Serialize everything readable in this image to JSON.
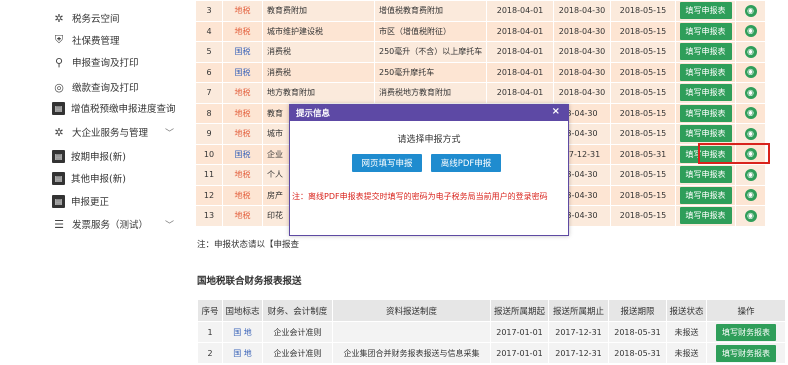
{
  "sidebar": {
    "items": [
      {
        "icon": "gear-icon",
        "glyph": "✲",
        "label": "税务云空间",
        "chev": false
      },
      {
        "icon": "shield-icon",
        "glyph": "⛨",
        "label": "社保费管理",
        "chev": false
      },
      {
        "icon": "search-icon",
        "glyph": "⚲",
        "label": "申报查询及打印",
        "chev": false
      },
      {
        "icon": "coin-icon",
        "glyph": "◎",
        "label": "缴款查询及打印",
        "chev": false
      },
      {
        "icon": "document-icon",
        "glyph": "▤",
        "label": "增值税预缴申报进度查询",
        "chev": false
      },
      {
        "icon": "gear-icon",
        "glyph": "✲",
        "label": "大企业服务与管理",
        "chev": true
      },
      {
        "icon": "document-icon",
        "glyph": "▤",
        "label": "按期申报(新)",
        "chev": false
      },
      {
        "icon": "document-icon",
        "glyph": "▤",
        "label": "其他申报(新)",
        "chev": false
      },
      {
        "icon": "document-icon",
        "glyph": "▤",
        "label": "申报更正",
        "chev": false
      },
      {
        "icon": "list-icon",
        "glyph": "☰",
        "label": "发票服务（测试）",
        "chev": true
      }
    ]
  },
  "top_table": {
    "rows": [
      {
        "no": "3",
        "tax": "地税",
        "tax_type": "dishui",
        "name": "教育费附加",
        "item": "增值税教育费附加",
        "start": "2018-04-01",
        "end": "2018-04-30",
        "deadline": "2018-05-15",
        "action": "填写申报表"
      },
      {
        "no": "4",
        "tax": "地税",
        "tax_type": "dishui",
        "name": "城市维护建设税",
        "item": "市区（增值税附征）",
        "start": "2018-04-01",
        "end": "2018-04-30",
        "deadline": "2018-05-15",
        "action": "填写申报表"
      },
      {
        "no": "5",
        "tax": "国税",
        "tax_type": "guoshui",
        "name": "消费税",
        "item": "250毫升（不含）以上摩托车",
        "start": "2018-04-01",
        "end": "2018-04-30",
        "deadline": "2018-05-15",
        "action": "填写申报表"
      },
      {
        "no": "6",
        "tax": "国税",
        "tax_type": "guoshui",
        "name": "消费税",
        "item": "250毫升摩托车",
        "start": "2018-04-01",
        "end": "2018-04-30",
        "deadline": "2018-05-15",
        "action": "填写申报表"
      },
      {
        "no": "7",
        "tax": "地税",
        "tax_type": "dishui",
        "name": "地方教育附加",
        "item": "消费税地方教育附加",
        "start": "2018-04-01",
        "end": "2018-04-30",
        "deadline": "2018-05-15",
        "action": "填写申报表"
      },
      {
        "no": "8",
        "tax": "地税",
        "tax_type": "dishui",
        "name": "教育",
        "item": "",
        "start": "",
        "end": "8-04-30",
        "deadline": "2018-05-15",
        "action": "填写申报表"
      },
      {
        "no": "9",
        "tax": "地税",
        "tax_type": "dishui",
        "name": "城市",
        "item": "",
        "start": "",
        "end": "8-04-30",
        "deadline": "2018-05-15",
        "action": "填写申报表"
      },
      {
        "no": "10",
        "tax": "国税",
        "tax_type": "guoshui",
        "name": "企业",
        "item": "",
        "start": "",
        "end": "17-12-31",
        "deadline": "2018-05-31",
        "action": "填写申报表"
      },
      {
        "no": "11",
        "tax": "地税",
        "tax_type": "dishui",
        "name": "个人",
        "item": "",
        "start": "",
        "end": "8-04-30",
        "deadline": "2018-05-15",
        "action": "填写申报表"
      },
      {
        "no": "12",
        "tax": "地税",
        "tax_type": "dishui",
        "name": "房产",
        "item": "",
        "start": "",
        "end": "8-04-30",
        "deadline": "2018-05-15",
        "action": "填写申报表"
      },
      {
        "no": "13",
        "tax": "地税",
        "tax_type": "dishui",
        "name": "印花",
        "item": "",
        "start": "",
        "end": "8-04-30",
        "deadline": "2018-05-15",
        "action": "填写申报表"
      }
    ]
  },
  "note": "注：申报状态请以【申报查",
  "section_title": "国地税联合财务报表报送",
  "bottom_table": {
    "headers": [
      "序号",
      "国地标志",
      "财务、会计制度",
      "资料报送制度",
      "报送所属期起",
      "报送所属期止",
      "报送期限",
      "报送状态",
      "操作"
    ],
    "rows": [
      {
        "no": "1",
        "flag": "国 地",
        "system": "企业会计准则",
        "scheme": "",
        "start": "2017-01-01",
        "end": "2017-12-31",
        "deadline": "2018-05-31",
        "status": "未报送",
        "action": "填写财务报表"
      },
      {
        "no": "2",
        "flag": "国 地",
        "system": "企业会计准则",
        "scheme": "企业集团合并财务报表报送与信息采集",
        "start": "2017-01-01",
        "end": "2017-12-31",
        "deadline": "2018-05-31",
        "status": "未报送",
        "action": "填写财务报表"
      }
    ]
  },
  "dialog": {
    "title": "提示信息",
    "close": "×",
    "prompt": "请选择申报方式",
    "btn_web": "网页填写申报",
    "btn_pdf": "离线PDF申报",
    "note": "注：离线PDF申报表提交时填写的密码为电子税务局当前用户的登录密码"
  },
  "colors": {
    "dialog_header": "#5d49a5",
    "primary_button": "#1f8ccf",
    "action_button": "#2f9e5a",
    "highlight": "#d9231c"
  }
}
